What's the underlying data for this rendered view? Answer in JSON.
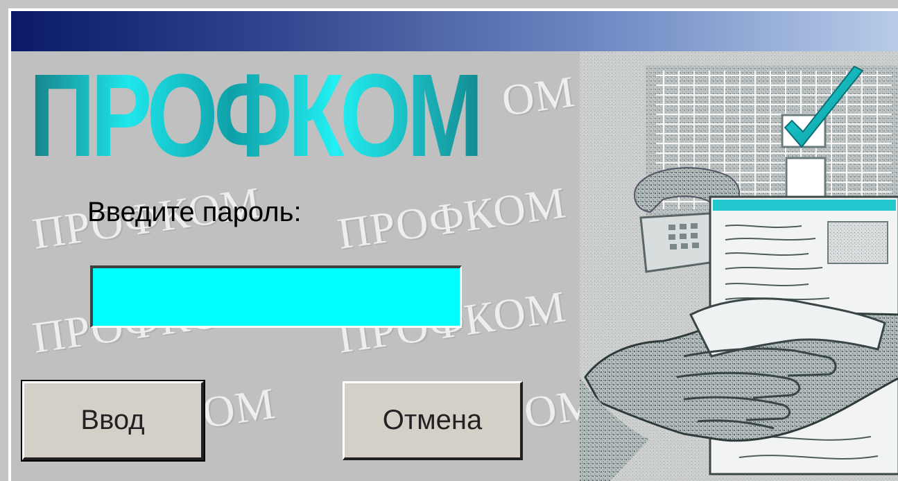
{
  "dialog": {
    "logo_text": "ПРОФКОМ",
    "watermark_word": "ПРОФКОМ",
    "watermark_fragment": "ОМ",
    "prompt_label": "Введите пароль:",
    "password_value": "",
    "ok_button_label": "Ввод",
    "cancel_button_label": "Отмена",
    "colors": {
      "title_gradient_start": "#0a1a66",
      "title_gradient_end": "#b8cce8",
      "password_field": "#00ffff",
      "logo": "#1ee7ec",
      "background": "#c0c0c0"
    },
    "illustration": "handshake-checklist-phone-icon"
  }
}
